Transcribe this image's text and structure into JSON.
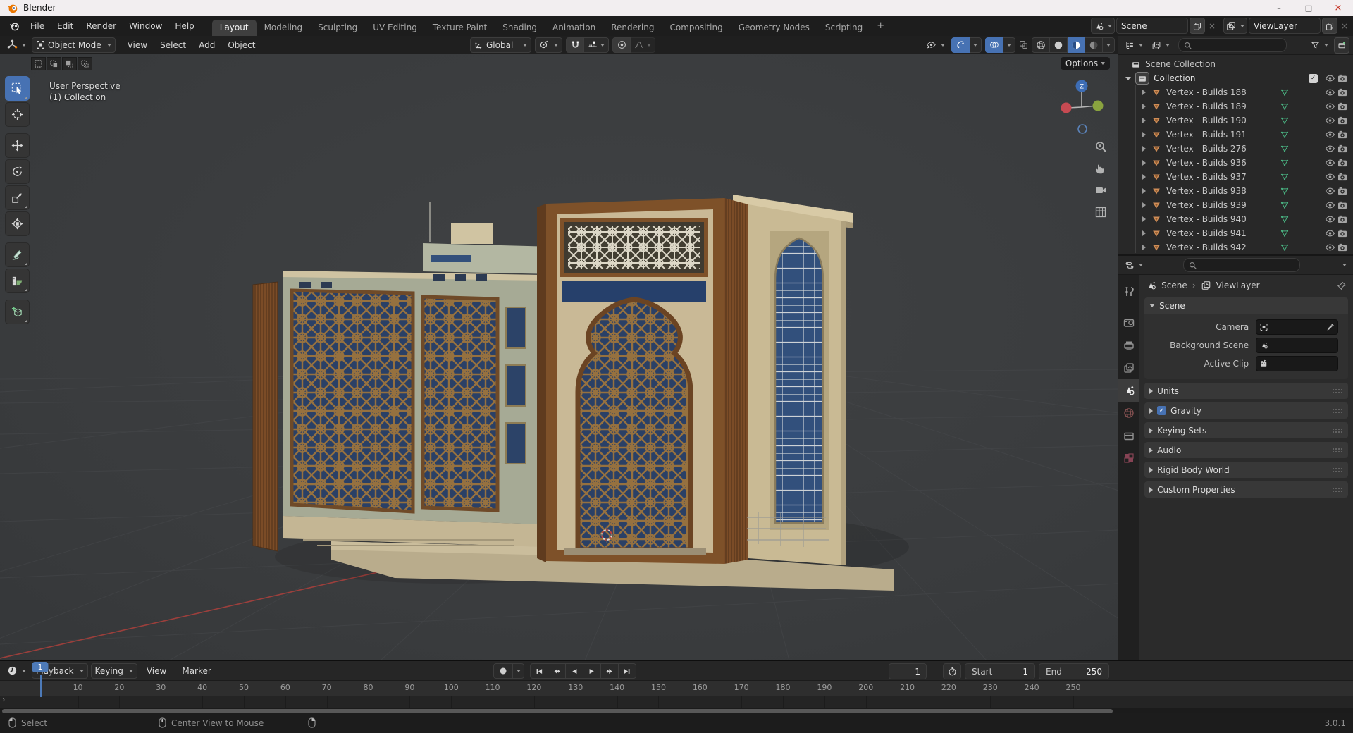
{
  "window": {
    "title": "Blender"
  },
  "topbar": {
    "menus": [
      "File",
      "Edit",
      "Render",
      "Window",
      "Help"
    ],
    "workspaces": [
      "Layout",
      "Modeling",
      "Sculpting",
      "UV Editing",
      "Texture Paint",
      "Shading",
      "Animation",
      "Rendering",
      "Compositing",
      "Geometry Nodes",
      "Scripting"
    ],
    "active_workspace": "Layout",
    "add_tab": "+",
    "scene_selector": {
      "label": "Scene"
    },
    "view_layer_selector": {
      "label": "ViewLayer"
    }
  },
  "viewport": {
    "mode": "Object Mode",
    "menus": [
      "View",
      "Select",
      "Add",
      "Object"
    ],
    "orientation": "Global",
    "options_label": "Options",
    "overlay": {
      "line1": "User Perspective",
      "line2": "(1) Collection"
    },
    "tools": [
      "tweak-select-box",
      "cursor-3d",
      "move",
      "rotate",
      "scale",
      "transform",
      "annotate",
      "measure",
      "add-cube"
    ],
    "active_tool": "tweak-select-box",
    "shading_modes": [
      "wireframe",
      "solid",
      "material-preview",
      "rendered"
    ],
    "active_shading": "material-preview",
    "nav_controls": [
      "zoom",
      "pan",
      "camera-view",
      "orthographic-toggle"
    ]
  },
  "outliner": {
    "root_label": "Scene Collection",
    "collection_label": "Collection",
    "items": [
      "Vertex - Builds 188",
      "Vertex - Builds 189",
      "Vertex - Builds 190",
      "Vertex - Builds 191",
      "Vertex - Builds 276",
      "Vertex - Builds 936",
      "Vertex - Builds 937",
      "Vertex - Builds 938",
      "Vertex - Builds 939",
      "Vertex - Builds 940",
      "Vertex - Builds 941",
      "Vertex - Builds 942"
    ]
  },
  "properties": {
    "breadcrumb": {
      "scene": "Scene",
      "view_layer": "ViewLayer"
    },
    "tabs": [
      "tool",
      "render",
      "output",
      "view-layer",
      "scene",
      "world",
      "collection",
      "texture"
    ],
    "active_tab": "scene",
    "scene_panel": {
      "title": "Scene",
      "fields": [
        {
          "label": "Camera"
        },
        {
          "label": "Background Scene"
        },
        {
          "label": "Active Clip"
        }
      ]
    },
    "panels": [
      {
        "label": "Units",
        "checkbox": false
      },
      {
        "label": "Gravity",
        "checkbox": true
      },
      {
        "label": "Keying Sets",
        "checkbox": false
      },
      {
        "label": "Audio",
        "checkbox": false
      },
      {
        "label": "Rigid Body World",
        "checkbox": false
      },
      {
        "label": "Custom Properties",
        "checkbox": false
      }
    ]
  },
  "timeline": {
    "menus": [
      "Playback",
      "Keying",
      "View",
      "Marker"
    ],
    "transport": [
      "jump-to-start",
      "previous-keyframe",
      "play-reverse",
      "play",
      "next-keyframe",
      "jump-to-end"
    ],
    "current_frame": "1",
    "start_label": "Start",
    "start_value": "1",
    "end_label": "End",
    "end_value": "250",
    "ruler_frames": [
      10,
      20,
      30,
      40,
      50,
      60,
      70,
      80,
      90,
      100,
      110,
      120,
      130,
      140,
      150,
      160,
      170,
      180,
      190,
      200,
      210,
      220,
      230,
      240,
      250
    ]
  },
  "statusbar": {
    "left_label": "Select",
    "middle_label": "Center View to Mouse",
    "version": "3.0.1"
  },
  "colors": {
    "accent": "#4772b3",
    "selection": "#4d7ab8",
    "mesh_icon": "#cf8d57",
    "mesh_data_icon": "#4ab583"
  }
}
